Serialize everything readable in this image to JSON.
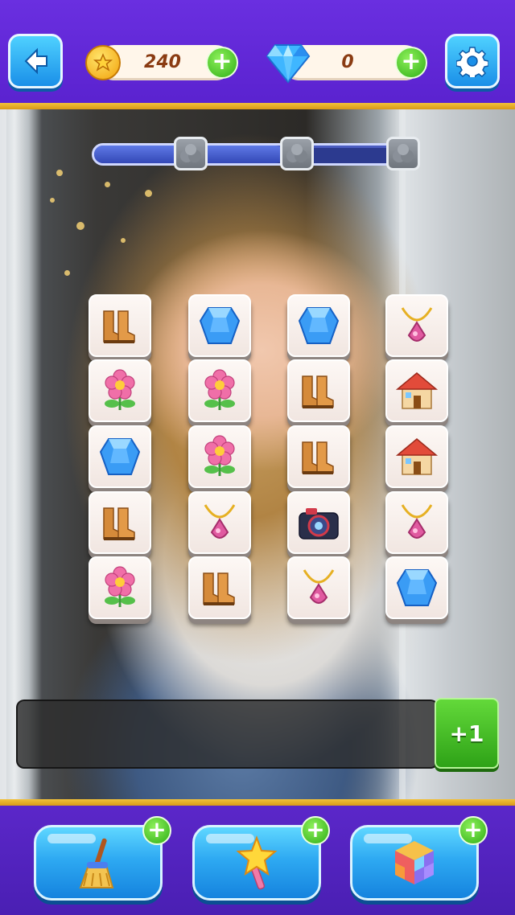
{
  "header": {
    "coins": "240",
    "gems": "0",
    "icons": [
      "back-arrow-icon",
      "coin-icon",
      "diamond-icon",
      "gear-icon",
      "plus-icon"
    ]
  },
  "progress": {
    "fill": 0.6,
    "stars_earned": 0,
    "stars_total": 3
  },
  "board": {
    "columns": 4,
    "rows": 5,
    "tiles": [
      [
        "boot",
        "gem",
        "gem",
        "necklace"
      ],
      [
        "flower",
        "flower",
        "boot",
        "house"
      ],
      [
        "gem",
        "flower",
        "boot",
        "house"
      ],
      [
        "boot",
        "necklace",
        "camera",
        "necklace"
      ],
      [
        "flower",
        "boot",
        "necklace",
        "gem"
      ]
    ]
  },
  "tray": {
    "extra_slot_label": "+1"
  },
  "boosters": [
    {
      "name": "broom",
      "icon": "broom-icon",
      "plus": "+"
    },
    {
      "name": "magic-wand",
      "icon": "star-wand-icon",
      "plus": "+"
    },
    {
      "name": "shuffle-cube",
      "icon": "cube-icon",
      "plus": "+"
    }
  ],
  "colors": {
    "topbar": "#6a2fe0",
    "gold_line": "#f2c23a",
    "button_blue": "#2ea9f2",
    "plus_green": "#2fae16",
    "progress_track": "#2c3a8f"
  }
}
